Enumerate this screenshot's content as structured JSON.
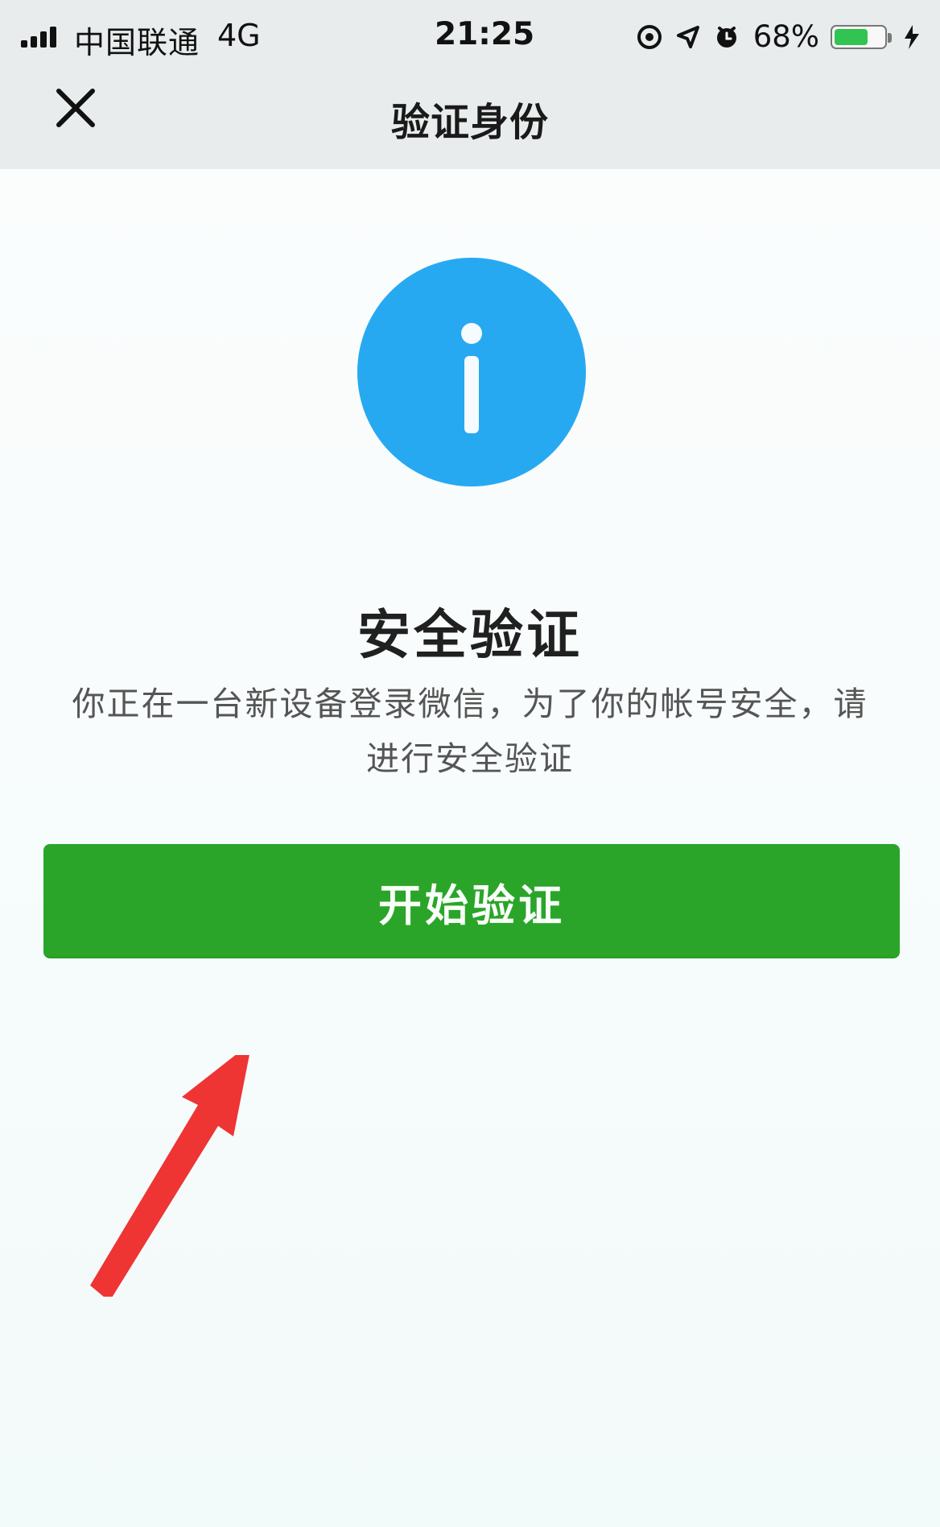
{
  "status_bar": {
    "carrier": "中国联通",
    "network": "4G",
    "time": "21:25",
    "battery_percent": "68%",
    "battery_level": 0.68,
    "icons": [
      "signal-icon",
      "rotation-lock-icon",
      "location-icon",
      "alarm-icon",
      "battery-icon",
      "charging-icon"
    ]
  },
  "navigation": {
    "close_icon": "close-icon",
    "title": "验证身份"
  },
  "main": {
    "icon": "info-icon",
    "icon_color": "#27a9f2",
    "title": "安全验证",
    "description": "你正在一台新设备登录微信，为了你的帐号安全，请进行安全验证",
    "button_label": "开始验证",
    "button_color": "#2aa529",
    "annotation_color": "#ef3434"
  }
}
